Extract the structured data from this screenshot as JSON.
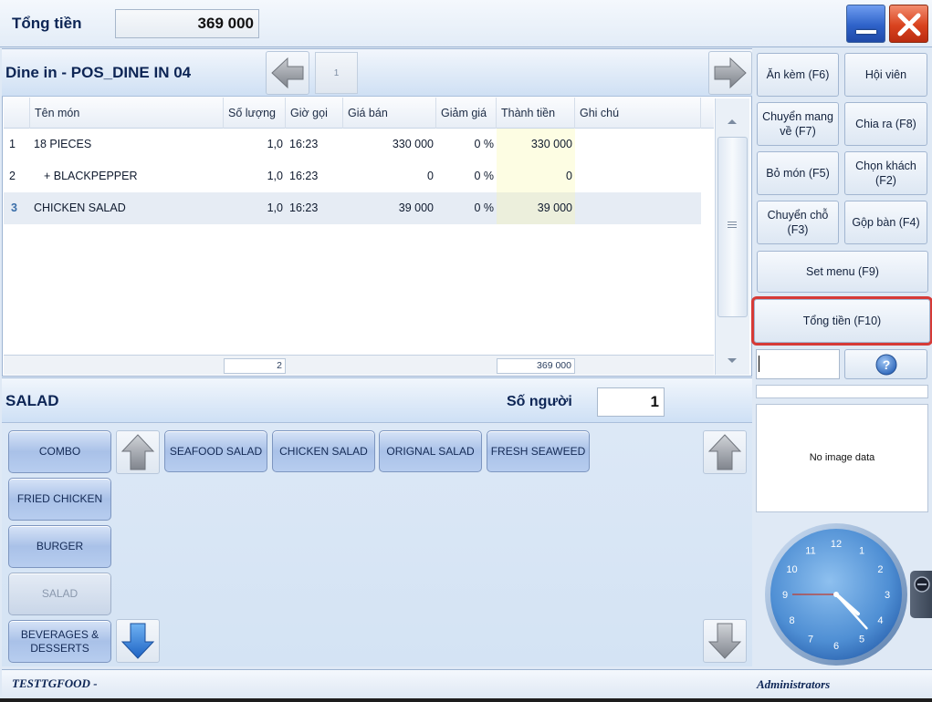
{
  "topbar": {
    "total_label": "Tổng tiền",
    "total_value": "369 000",
    "minimize_icon": "minimize-icon",
    "close_icon": "close-icon"
  },
  "order": {
    "title": "Dine in - POS_DINE IN 04",
    "page": "1",
    "columns": [
      "Tên món",
      "Số lượng",
      "Giờ gọi",
      "Giá bán",
      "Giảm giá",
      "Thành tiền",
      "Ghi chú"
    ],
    "rows": [
      {
        "no": "1",
        "name": "18 PIECES",
        "qty": "1,0",
        "time": "16:23",
        "price": "330 000",
        "discount": "0 %",
        "amount": "330 000",
        "note": ""
      },
      {
        "no": "2",
        "name": "+ BLACKPEPPER",
        "qty": "1,0",
        "time": "16:23",
        "price": "0",
        "discount": "0 %",
        "amount": "0",
        "note": ""
      },
      {
        "no": "3",
        "name": "CHICKEN SALAD",
        "qty": "1,0",
        "time": "16:23",
        "price": "39 000",
        "discount": "0 %",
        "amount": "39 000",
        "note": ""
      }
    ],
    "footer_qty": "2",
    "footer_amount": "369 000"
  },
  "category": {
    "title": "SALAD",
    "people_label": "Số người",
    "people_value": "1",
    "categories": [
      "COMBO",
      "FRIED CHICKEN",
      "BURGER",
      "SALAD",
      "BEVERAGES & DESSERTS"
    ],
    "active_category": "SALAD",
    "items": [
      "SEAFOOD SALAD",
      "CHICKEN SALAD",
      "ORIGNAL SALAD",
      "FRESH SEAWEED"
    ]
  },
  "functions": {
    "an_kem": "Ăn kèm (F6)",
    "hoi_vien": "Hội viên",
    "chuyen_mang_ve_1": "Chuyển mang",
    "chuyen_mang_ve_2": "về (F7)",
    "chia_ra": "Chia ra (F8)",
    "bo_mon": "Bỏ món (F5)",
    "chon_khach_1": "Chọn khách",
    "chon_khach_2": "(F2)",
    "chuyen_cho_1": "Chuyển chỗ",
    "chuyen_cho_2": "(F3)",
    "gop_ban": "Gộp bàn (F4)",
    "set_menu": "Set menu (F9)",
    "tong_tien": "Tổng tiền (F10)",
    "no_image": "No image data"
  },
  "clock": {
    "hours": [
      "12",
      "1",
      "2",
      "3",
      "4",
      "5",
      "6",
      "7",
      "8",
      "9",
      "10",
      "11"
    ],
    "time": "16:23"
  },
  "status": {
    "left": "TESTTGFOOD -",
    "right": "Administrators"
  },
  "colors": {
    "accent": "#0d2555",
    "highlight": "#d63a37",
    "amount_bg": "#fdfde3"
  }
}
